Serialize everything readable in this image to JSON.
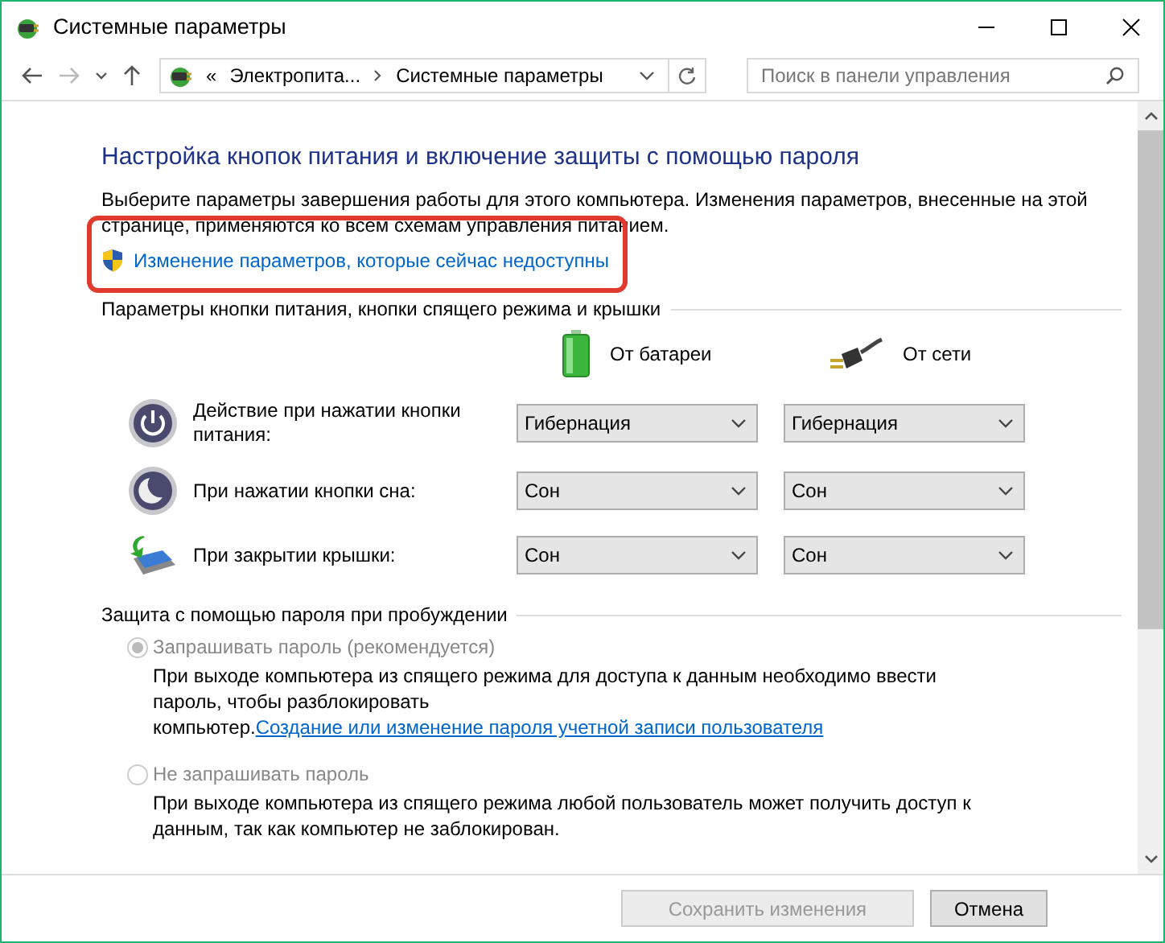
{
  "window": {
    "title": "Системные параметры"
  },
  "address_bar": {
    "overflow": "«",
    "crumbs": [
      "Электропита...",
      "Системные параметры"
    ]
  },
  "search": {
    "placeholder": "Поиск в панели управления"
  },
  "page": {
    "heading": "Настройка кнопок питания и включение защиты с помощью пароля",
    "intro": "Выберите параметры завершения работы для этого компьютера. Изменения параметров, внесенные на этой странице, применяются ко всем схемам управления питанием.",
    "admin_link": {
      "text": "Изменение параметров, которые сейчас недоступны",
      "highlighted": true
    }
  },
  "power_section": {
    "title": "Параметры кнопки питания, кнопки спящего режима и крышки",
    "columns": [
      "От батареи",
      "От сети"
    ],
    "rows": [
      {
        "kind": "power",
        "label": "Действие при нажатии кнопки питания:",
        "values": [
          "Гибернация",
          "Гибернация"
        ]
      },
      {
        "kind": "sleep",
        "label": "При нажатии кнопки сна:",
        "values": [
          "Сон",
          "Сон"
        ]
      },
      {
        "kind": "lid",
        "label": "При закрытии крышки:",
        "values": [
          "Сон",
          "Сон"
        ]
      }
    ]
  },
  "password_section": {
    "title": "Защита с помощью пароля при пробуждении",
    "options": [
      {
        "label": "Запрашивать пароль (рекомендуется)",
        "selected": true,
        "disabled": true,
        "description": "При выходе компьютера из спящего режима для доступа к данным необходимо ввести пароль, чтобы разблокировать компьютер.",
        "link": "Создание или изменение пароля учетной записи пользователя"
      },
      {
        "label": "Не запрашивать пароль",
        "selected": false,
        "disabled": true,
        "description": "При выходе компьютера из спящего режима любой пользователь может получить доступ к данным, так как компьютер не заблокирован."
      }
    ]
  },
  "buttons": [
    {
      "label": "Сохранить изменения",
      "disabled": true
    },
    {
      "label": "Отмена",
      "disabled": false
    }
  ]
}
